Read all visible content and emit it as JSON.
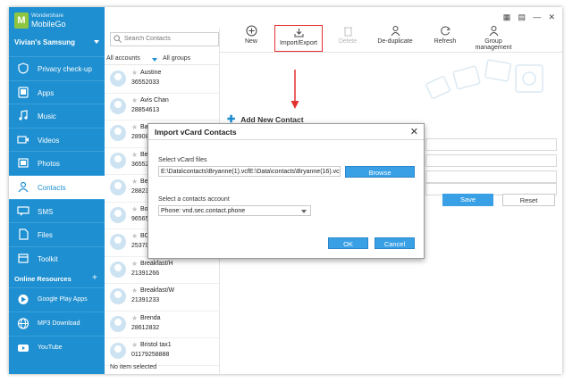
{
  "app": {
    "brand_small": "Wondershare",
    "brand_name": "MobileGo",
    "logo_letter": "M",
    "device_name": "Vivian's Samsung"
  },
  "sidebar": {
    "items": [
      {
        "label": "Privacy check-up",
        "icon": "shield-icon"
      },
      {
        "label": "Apps",
        "icon": "apps-icon"
      },
      {
        "label": "Music",
        "icon": "music-icon"
      },
      {
        "label": "Videos",
        "icon": "video-icon"
      },
      {
        "label": "Photos",
        "icon": "photo-icon"
      },
      {
        "label": "Contacts",
        "icon": "contacts-icon",
        "active": true
      },
      {
        "label": "SMS",
        "icon": "sms-icon"
      },
      {
        "label": "Files",
        "icon": "files-icon"
      },
      {
        "label": "Toolkit",
        "icon": "toolkit-icon"
      }
    ],
    "online_title": "Online Resources",
    "online_items": [
      {
        "label": "Google Play Apps",
        "icon": "google-play-icon"
      },
      {
        "label": "MP3 Download",
        "icon": "mp3-icon"
      },
      {
        "label": "YouTube",
        "icon": "youtube-icon"
      }
    ]
  },
  "toolbar": {
    "new_label": "New",
    "import_export_label": "Import/Export",
    "delete_label": "Delete",
    "dedup_label": "De-duplicate",
    "refresh_label": "Refresh",
    "group_label_1": "Group",
    "group_label_2": "management"
  },
  "list": {
    "search_placeholder": "Search Contacts",
    "filter_accounts": "All accounts",
    "filter_groups": "All groups",
    "contacts": [
      {
        "name": "Austine",
        "phone": "36552033"
      },
      {
        "name": "Avis Chan",
        "phone": "28854613"
      },
      {
        "name": "Bab",
        "phone": "28908"
      },
      {
        "name": "Bere",
        "phone": "36552"
      },
      {
        "name": "Bern",
        "phone": "28823"
      },
      {
        "name": "Bon",
        "phone": "96565"
      },
      {
        "name": "BON",
        "phone": "25370"
      },
      {
        "name": "Breakfast/H",
        "phone": "21391266"
      },
      {
        "name": "Breakfast/W",
        "phone": "21391233"
      },
      {
        "name": "Brenda",
        "phone": "28612832"
      },
      {
        "name": "Bristol tax1",
        "phone": "01179258888"
      }
    ],
    "status": "No item selected"
  },
  "detail": {
    "add_new_contact": "Add New Contact",
    "save_label": "Save",
    "reset_label": "Reset"
  },
  "modal": {
    "title": "Import vCard Contacts",
    "files_label": "Select vCard files",
    "files_value": "E:\\Data\\contacts\\Bryanne(1).vcfE:\\Data\\contacts\\Bryanne(16).vcfE:",
    "browse_label": "Browse",
    "account_label": "Select a contacts account",
    "account_value": "Phone: vnd.sec.contact.phone",
    "ok_label": "OK",
    "cancel_label": "Cancel"
  },
  "colors": {
    "accent": "#1e8fd0",
    "button_blue": "#3aa0e6",
    "highlight_red": "#e53030",
    "logo_green": "#8fc641"
  }
}
